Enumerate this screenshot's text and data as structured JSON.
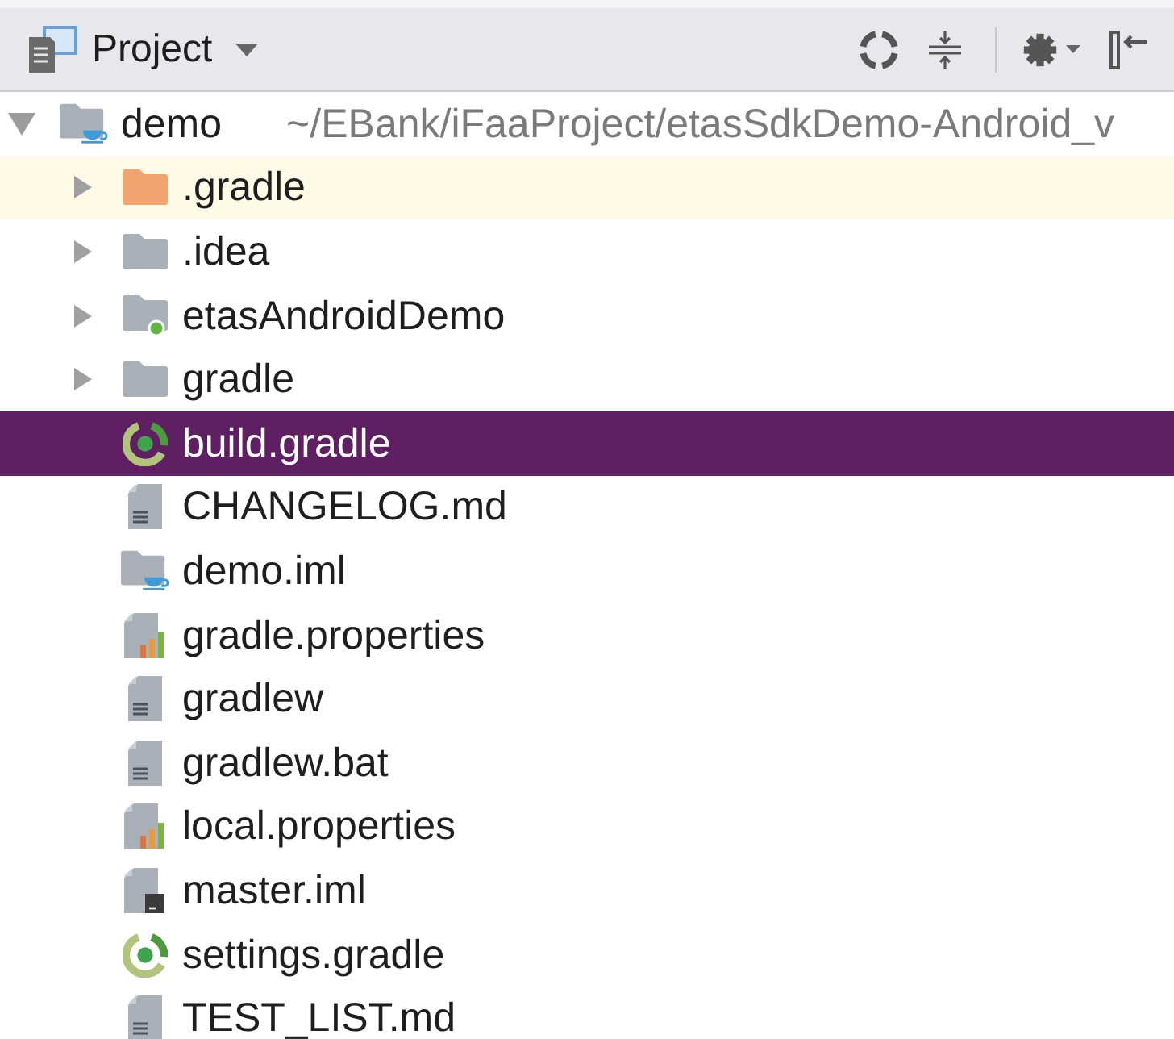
{
  "panel": {
    "title": "Project"
  },
  "tree": [
    {
      "name": "demo",
      "path": "~/EBank/iFaaProject/etasSdkDemo-Android_v",
      "kind": "module",
      "expanded": true,
      "selected": false,
      "highlighted": false,
      "children": [
        {
          "name": ".gradle",
          "kind": "excluded-folder",
          "expanded": false,
          "selected": false,
          "highlighted": true
        },
        {
          "name": ".idea",
          "kind": "folder",
          "expanded": false,
          "selected": false,
          "highlighted": false
        },
        {
          "name": "etasAndroidDemo",
          "kind": "module-folder",
          "expanded": false,
          "selected": false,
          "highlighted": false
        },
        {
          "name": "gradle",
          "kind": "folder",
          "expanded": false,
          "selected": false,
          "highlighted": false
        },
        {
          "name": "build.gradle",
          "kind": "gradle",
          "selected": true,
          "highlighted": false
        },
        {
          "name": "CHANGELOG.md",
          "kind": "text",
          "selected": false,
          "highlighted": false
        },
        {
          "name": "demo.iml",
          "kind": "module",
          "selected": false,
          "highlighted": false
        },
        {
          "name": "gradle.properties",
          "kind": "properties",
          "selected": false,
          "highlighted": false
        },
        {
          "name": "gradlew",
          "kind": "text",
          "selected": false,
          "highlighted": false
        },
        {
          "name": "gradlew.bat",
          "kind": "text",
          "selected": false,
          "highlighted": false
        },
        {
          "name": "local.properties",
          "kind": "properties",
          "selected": false,
          "highlighted": false
        },
        {
          "name": "master.iml",
          "kind": "terminal-file",
          "selected": false,
          "highlighted": false
        },
        {
          "name": "settings.gradle",
          "kind": "gradle",
          "selected": false,
          "highlighted": false
        },
        {
          "name": "TEST_LIST.md",
          "kind": "text",
          "selected": false,
          "highlighted": false
        }
      ]
    }
  ]
}
